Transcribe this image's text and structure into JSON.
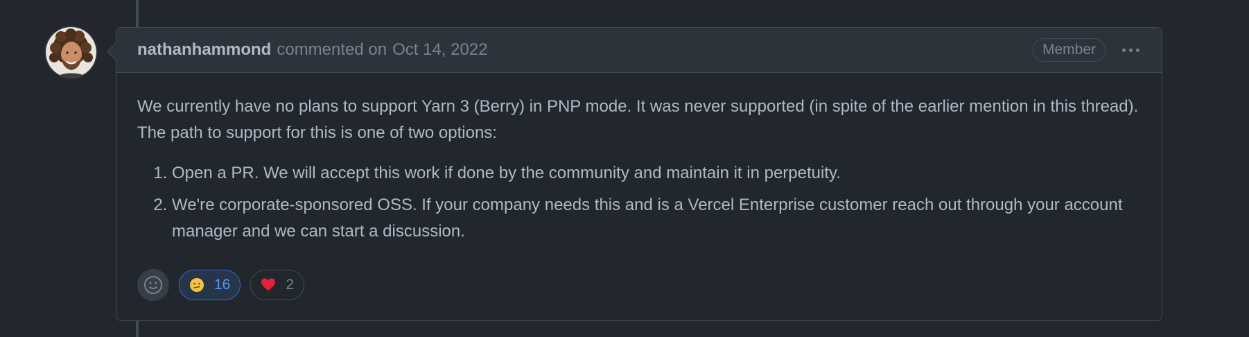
{
  "comment": {
    "author": "nathanhammond",
    "action": "commented on",
    "date": "Oct 14, 2022",
    "badge": "Member",
    "body_paragraph": "We currently have no plans to support Yarn 3 (Berry) in PNP mode. It was never supported (in spite of the earlier mention in this thread). The path to support for this is one of two options:",
    "list_items": [
      "Open a PR. We will accept this work if done by the community and maintain it in perpetuity.",
      "We're corporate-sponsored OSS. If your company needs this and is a Vercel Enterprise customer reach out through your account manager and we can start a discussion."
    ]
  },
  "reactions": [
    {
      "icon": "confused-face-icon",
      "count": "16",
      "active": true
    },
    {
      "icon": "heart-icon",
      "count": "2",
      "active": false
    }
  ],
  "colors": {
    "background": "#22272e",
    "header_bg": "#2d333b",
    "border": "#444c56",
    "text": "#adbac7",
    "muted": "#768390",
    "accent": "#539bf5"
  }
}
